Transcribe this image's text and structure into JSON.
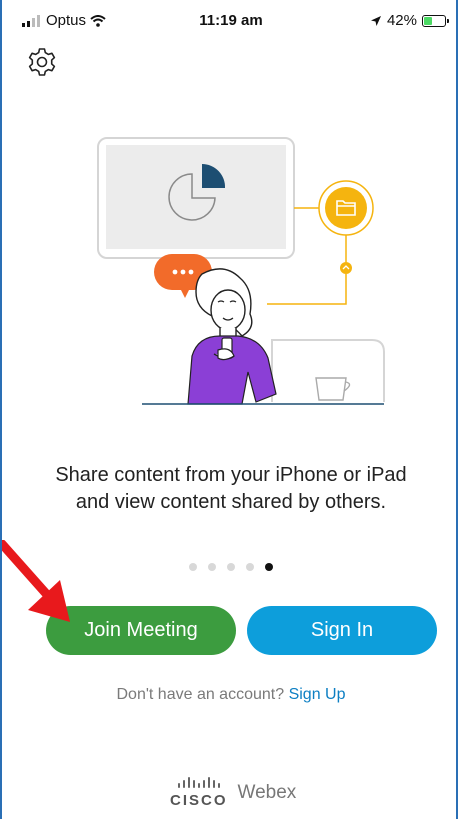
{
  "status_bar": {
    "carrier": "Optus",
    "time": "11:19 am",
    "battery_percent": "42%",
    "battery_level": 0.42,
    "signal_bars": 2
  },
  "icons": {
    "settings": "gear-icon",
    "wifi": "wifi-icon",
    "location": "location-arrow-icon",
    "battery": "battery-charging-icon",
    "chat": "chat-bubble-icon",
    "folder": "folder-icon",
    "cup": "coffee-cup-icon"
  },
  "onboarding": {
    "caption": "Share content from your iPhone or iPad and view content shared by others.",
    "page_count": 5,
    "active_page": 5
  },
  "actions": {
    "join_meeting_label": "Join Meeting",
    "sign_in_label": "Sign In",
    "no_account_text": "Don't have an account?",
    "sign_up_label": "Sign Up"
  },
  "branding": {
    "cisco_wordmark": "CISCO",
    "product_name": "Webex"
  },
  "colors": {
    "join_button": "#3c9c3f",
    "sign_in_button": "#0d9edb",
    "link": "#0d7fc3",
    "annotation_arrow": "#e8191c",
    "chat_bubble": "#f26b2a",
    "folder_badge": "#f5b40f",
    "person_shirt": "#8b3fd6",
    "chart_slice": "#1d4e72"
  }
}
